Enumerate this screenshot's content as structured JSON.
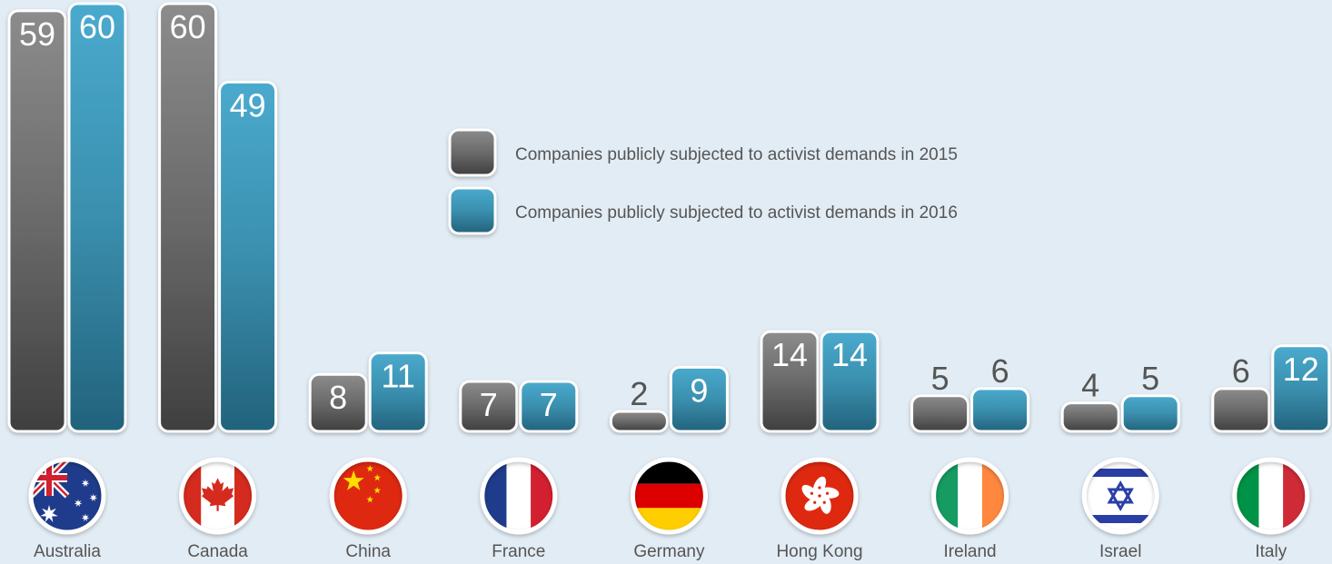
{
  "colors": {
    "background": "#e2ecf4",
    "series_2015": "#6a6a6a",
    "series_2016": "#3a8fae",
    "text": "#555555"
  },
  "legend": {
    "label_2015": "Companies publicly subjected to activist demands in 2015",
    "label_2016": "Companies publicly subjected to activist demands in 2016"
  },
  "chart_data": {
    "type": "bar",
    "categories": [
      "Australia",
      "Canada",
      "China",
      "France",
      "Germany",
      "Hong Kong",
      "Ireland",
      "Israel",
      "Italy"
    ],
    "flag_icons": [
      "australia-flag-icon",
      "canada-flag-icon",
      "china-flag-icon",
      "france-flag-icon",
      "germany-flag-icon",
      "hong-kong-flag-icon",
      "ireland-flag-icon",
      "israel-flag-icon",
      "italy-flag-icon"
    ],
    "series": [
      {
        "name": "Companies publicly subjected to activist demands in 2015",
        "values": [
          59,
          60,
          8,
          7,
          2,
          14,
          5,
          4,
          6
        ]
      },
      {
        "name": "Companies publicly subjected to activist demands in 2016",
        "values": [
          60,
          49,
          11,
          7,
          9,
          14,
          6,
          5,
          12
        ]
      }
    ],
    "title": "",
    "xlabel": "",
    "ylabel": "",
    "ylim": [
      0,
      60
    ],
    "grid": false,
    "legend_position": "top-center"
  }
}
